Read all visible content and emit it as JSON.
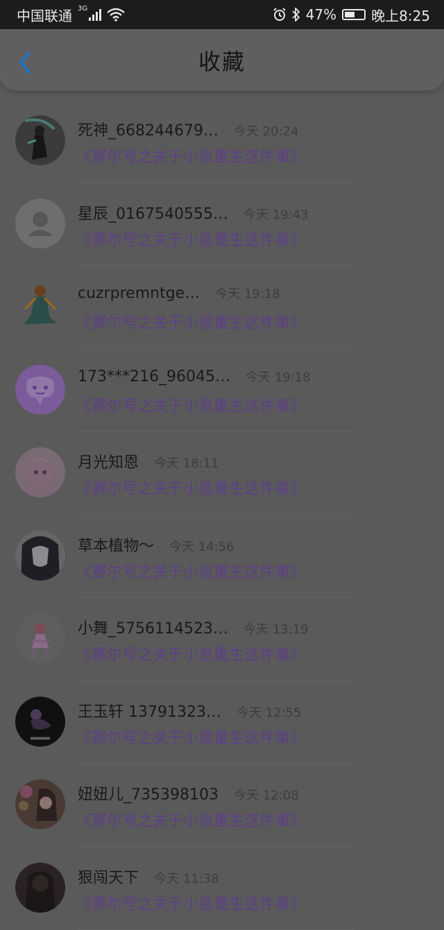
{
  "status_bar": {
    "carrier": "中国联通",
    "network": "3G",
    "battery": "47%",
    "time": "晚上8:25",
    "icons": [
      "signal-icon",
      "wifi-icon",
      "alarm-icon",
      "bluetooth-icon",
      "battery-icon"
    ]
  },
  "header": {
    "title": "收藏",
    "back_icon": "chevron-left-icon"
  },
  "colors": {
    "accent": "#1976d2",
    "book_title": "#5d3f86"
  },
  "items": [
    {
      "name": "死神_668244679…",
      "time": "今天 20:24",
      "book": "《赛尔号之关于小息重生这件事》"
    },
    {
      "name": "星辰_0167540555…",
      "time": "今天 19:43",
      "book": "《赛尔号之关于小息重生这件事》"
    },
    {
      "name": "cuzrpremntge…",
      "time": "今天 19:18",
      "book": "《赛尔号之关于小息重生这件事》"
    },
    {
      "name": "173***216_96045…",
      "time": "今天 19:18",
      "book": "《赛尔号之关于小息重生这件事》"
    },
    {
      "name": "月光知恩",
      "time": "今天 18:11",
      "book": "《赛尔号之关于小息重生这件事》"
    },
    {
      "name": "草本植物～",
      "time": "今天 14:56",
      "book": "《赛尔号之关于小息重生这件事》"
    },
    {
      "name": "小舞_5756114523…",
      "time": "今天 13:19",
      "book": "《赛尔号之关于小息重生这件事》"
    },
    {
      "name": "王玉轩 13791323…",
      "time": "今天 12:55",
      "book": "《赛尔号之关于小息重生这件事》"
    },
    {
      "name": "妞妞儿_735398103",
      "time": "今天 12:08",
      "book": "《赛尔号之关于小息重生这件事》"
    },
    {
      "name": "狠闯天下",
      "time": "今天 11:38",
      "book": "《赛尔号之关于小息重生这件事》"
    }
  ]
}
